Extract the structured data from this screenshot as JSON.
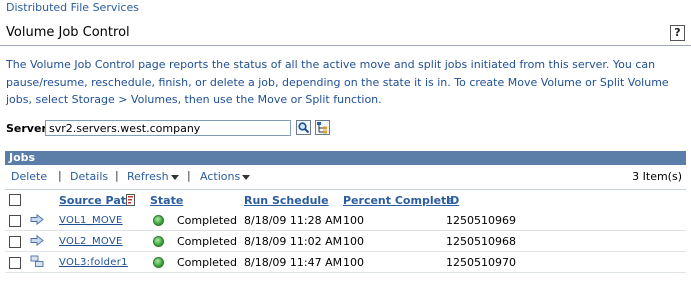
{
  "breadcrumb": "Distributed File Services",
  "page": {
    "title": "Volume Job Control",
    "help_label": "?",
    "description": "The Volume Job Control page reports the status of all the active move and split jobs initiated from this server. You can pause/resume, reschedule, finish, or delete a job, depending on the state it is in. To create Move Volume or Split Volume jobs, select Storage > Volumes, then use the Move or Split function."
  },
  "server": {
    "label": "Server:",
    "value": "svr2.servers.west.company",
    "icons": [
      "search-icon",
      "browse-tree-icon"
    ]
  },
  "jobs": {
    "section_title": "Jobs",
    "toolbar": {
      "delete": "Delete",
      "details": "Details",
      "refresh": "Refresh",
      "actions": "Actions",
      "separator": "|",
      "count": "3 Item(s)"
    },
    "columns": {
      "source_path": "Source Path",
      "state": "State",
      "run_schedule": "Run Schedule",
      "percent_complete": "Percent Complete",
      "id": "ID"
    },
    "rows": [
      {
        "type_icon": "move-arrow-icon",
        "source": "VOL1_MOVE",
        "state": "Completed",
        "schedule": "8/18/09 11:28 AM",
        "percent": "100",
        "id": "1250510969"
      },
      {
        "type_icon": "move-arrow-icon",
        "source": "VOL2_MOVE",
        "state": "Completed",
        "schedule": "8/18/09 11:02 AM",
        "percent": "100",
        "id": "1250510968"
      },
      {
        "type_icon": "split-volume-icon",
        "source": "VOL3:folder1",
        "state": "Completed",
        "schedule": "8/18/09 11:47 AM",
        "percent": "100",
        "id": "1250510970"
      }
    ]
  },
  "colors": {
    "link": "#2a5d9f",
    "section_header": "#5a7ea8",
    "status_ok": "#3aa53a"
  }
}
